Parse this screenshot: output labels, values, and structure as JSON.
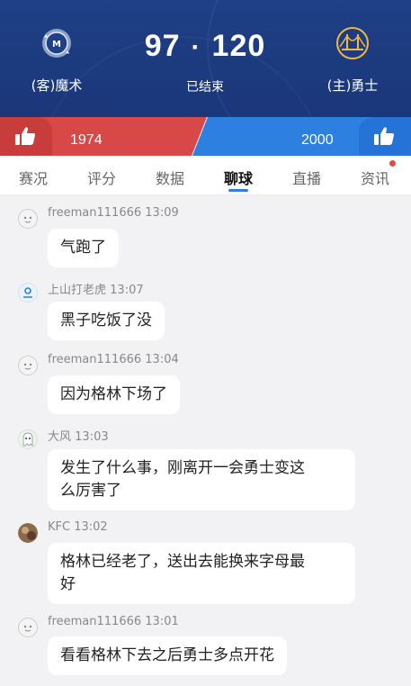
{
  "match": {
    "away_team": "(客)魔术",
    "home_team": "(主)勇士",
    "away_score": "97",
    "separator": "·",
    "home_score": "120",
    "status": "已结束"
  },
  "votes": {
    "away": "1974",
    "home": "2000"
  },
  "tabs": [
    {
      "label": "赛况"
    },
    {
      "label": "评分"
    },
    {
      "label": "数据"
    },
    {
      "label": "聊球"
    },
    {
      "label": "直播"
    },
    {
      "label": "资讯"
    }
  ],
  "active_tab": "聊球",
  "messages": [
    {
      "user": "freeman111666",
      "time": "13:09",
      "text": "气跑了",
      "avatar": "default-face-icon"
    },
    {
      "user": "上山打老虎",
      "time": "13:07",
      "text": "黑子吃饭了没",
      "avatar": "blue-user-icon"
    },
    {
      "user": "freeman111666",
      "time": "13:04",
      "text": "因为格林下场了",
      "avatar": "default-face-icon"
    },
    {
      "user": "大风",
      "time": "13:03",
      "text_line1": "发生了什么事，刚离开一会勇士变这",
      "text_line2": "么厉害了",
      "avatar": "ghost-icon"
    },
    {
      "user": "KFC",
      "time": "13:02",
      "text_line1": "格林已经老了，送出去能换来字母最",
      "text_line2": "好",
      "avatar": "photo-avatar"
    },
    {
      "user": "freeman111666",
      "time": "13:01",
      "text": "看看格林下去之后勇士多点开花",
      "avatar": "default-face-icon"
    }
  ],
  "colors": {
    "header_bg": "#1f3f86",
    "away_vote": "#d84848",
    "home_vote": "#2d7fe0",
    "tab_accent": "#2d7fe0",
    "notify_dot": "#e8483f"
  }
}
